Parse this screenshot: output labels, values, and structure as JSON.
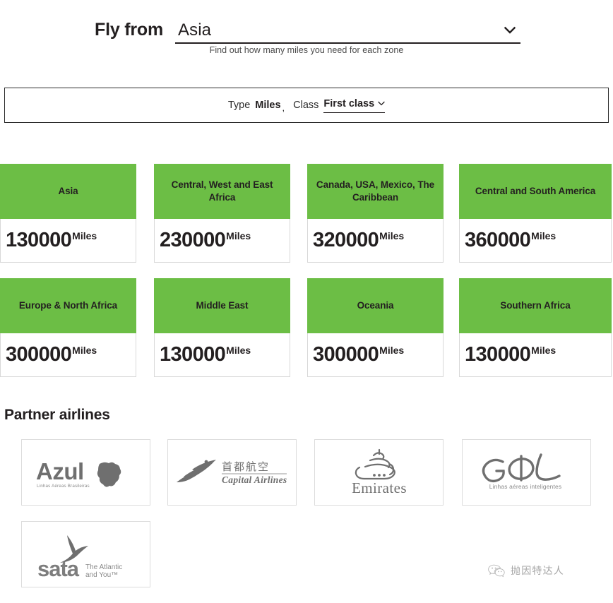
{
  "header": {
    "fly_from_label": "Fly from",
    "selected_region": "Asia",
    "dropdown_icon": "chevron-down-icon",
    "subnote": "Find out how many miles you need for each zone"
  },
  "filters": {
    "type_label": "Type",
    "type_value": "Miles",
    "separator": ",",
    "class_label": "Class",
    "class_value": "First class",
    "class_dropdown_icon": "chevron-down-icon"
  },
  "colors": {
    "zone_green": "#6cbe45",
    "text_dark": "#231f20",
    "card_border": "#d8d8d8"
  },
  "zones": [
    {
      "title": "Asia",
      "amount": "130000",
      "unit": "Miles"
    },
    {
      "title": "Central, West and East Africa",
      "amount": "230000",
      "unit": "Miles"
    },
    {
      "title": "Canada, USA, Mexico, The Caribbean",
      "amount": "320000",
      "unit": "Miles"
    },
    {
      "title": "Central and South America",
      "amount": "360000",
      "unit": "Miles"
    },
    {
      "title": "Europe & North Africa",
      "amount": "300000",
      "unit": "Miles"
    },
    {
      "title": "Middle East",
      "amount": "130000",
      "unit": "Miles"
    },
    {
      "title": "Oceania",
      "amount": "300000",
      "unit": "Miles"
    },
    {
      "title": "Southern Africa",
      "amount": "130000",
      "unit": "Miles"
    }
  ],
  "partners": {
    "heading": "Partner airlines",
    "logos": [
      {
        "name": "azul-logo",
        "wordmark": "Azul",
        "tagline": "Linhas Aéreas Brasileiras"
      },
      {
        "name": "capital-airlines-logo",
        "wordmark": "首都航空",
        "tagline": "Capital Airlines"
      },
      {
        "name": "emirates-logo",
        "wordmark": "Emirates",
        "tagline": ""
      },
      {
        "name": "gol-logo",
        "wordmark": "GOL",
        "tagline": "Linhas aéreas inteligentes"
      },
      {
        "name": "sata-logo",
        "wordmark": "sata",
        "tagline": "The Atlantic and You™"
      }
    ]
  },
  "watermark": {
    "icon": "wechat-icon",
    "text": "抛因特达人"
  }
}
